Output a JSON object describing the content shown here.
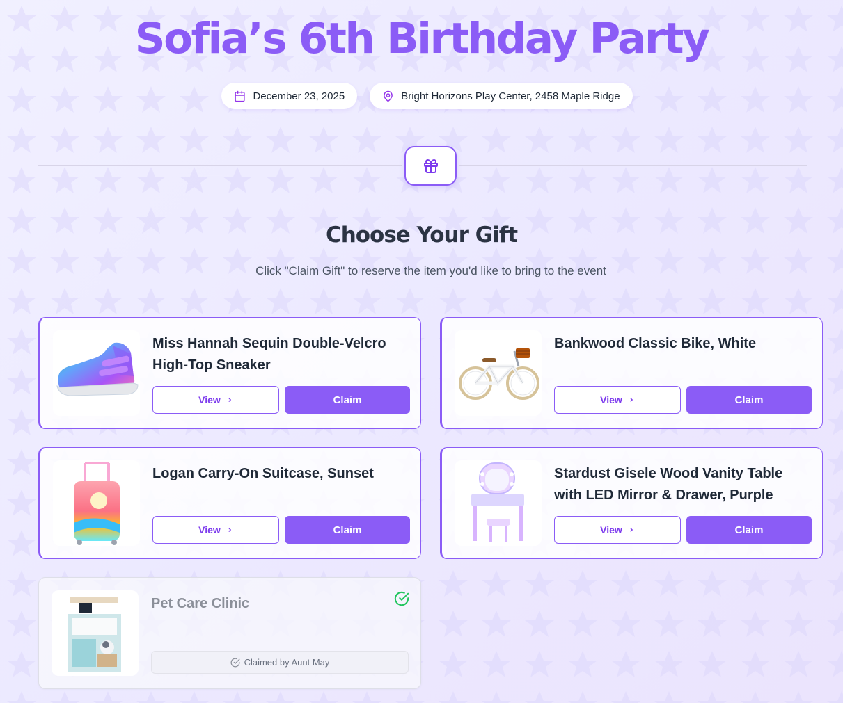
{
  "event": {
    "title": "Sofia’s 6th Birthday Party",
    "date": "December 23, 2025",
    "location": "Bright Horizons Play Center, 2458 Maple Ridge"
  },
  "section": {
    "title": "Choose Your Gift",
    "subtitle": "Click \"Claim Gift\" to reserve the item you'd like to bring to the event"
  },
  "gifts": [
    {
      "name": "Miss Hannah Sequin Double-Velcro High-Top Sneaker",
      "view_label": "View",
      "claim_label": "Claim",
      "image": "sneaker"
    },
    {
      "name": "Bankwood Classic Bike, White",
      "view_label": "View",
      "claim_label": "Claim",
      "image": "bike"
    },
    {
      "name": "Logan Carry-On Suitcase, Sunset",
      "view_label": "View",
      "claim_label": "Claim",
      "image": "suitcase"
    },
    {
      "name": "Stardust Gisele Wood Vanity Table with LED Mirror & Drawer, Purple",
      "view_label": "View",
      "claim_label": "Claim",
      "image": "vanity"
    },
    {
      "name": "Pet Care Clinic",
      "claimed": true,
      "claimed_text": "Claimed by Aunt May",
      "image": "pet-clinic"
    }
  ],
  "colors": {
    "accent": "#8b5cf6",
    "success": "#22c55e"
  },
  "icons": [
    "calendar-icon",
    "map-pin-icon",
    "gift-icon",
    "chevron-right-icon",
    "check-circle-icon"
  ]
}
